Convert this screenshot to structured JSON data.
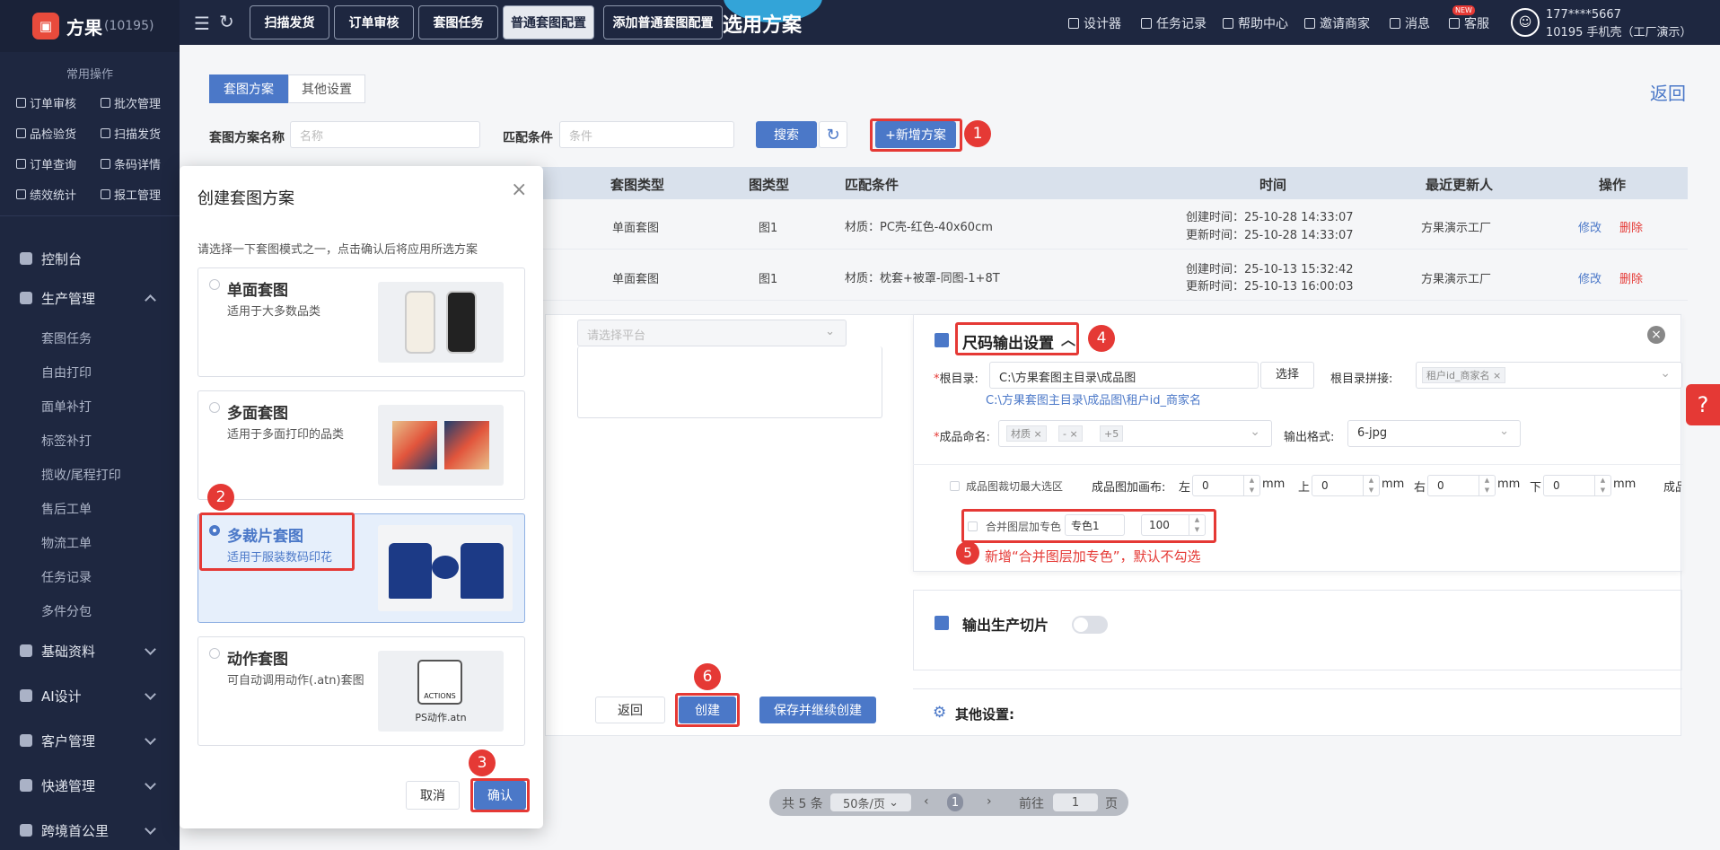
{
  "app": {
    "name": "方果",
    "account": "(10195)"
  },
  "sidebar": {
    "common_title": "常用操作",
    "quick": [
      "订单审核",
      "批次管理",
      "品检验货",
      "扫描发货",
      "订单查询",
      "条码详情",
      "绩效统计",
      "报工管理"
    ],
    "menus": [
      {
        "label": "控制台"
      },
      {
        "label": "生产管理"
      },
      {
        "label": "基础资料"
      },
      {
        "label": "AI设计"
      },
      {
        "label": "客户管理"
      },
      {
        "label": "快递管理"
      },
      {
        "label": "跨境首公里"
      }
    ],
    "submenu": [
      "套图任务",
      "自由打印",
      "面单补打",
      "标签补打",
      "揽收/尾程打印",
      "售后工单",
      "物流工单",
      "任务记录",
      "多件分包"
    ]
  },
  "topbar": {
    "tabs": [
      "扫描发货",
      "订单审核",
      "套图任务",
      "普通套图配置",
      "添加普通套图配置"
    ],
    "page_title_fragment": "选用方案",
    "nav": [
      "设计器",
      "任务记录",
      "帮助中心",
      "邀请商家",
      "消息",
      "客服"
    ],
    "new_badge": "NEW",
    "user_phone": "177****5667",
    "user_info": "10195 手机壳（工厂演示）"
  },
  "main": {
    "tabs": [
      "套图方案",
      "其他设置"
    ],
    "back_label": "返回",
    "filters": {
      "name_label": "套图方案名称",
      "name_placeholder": "名称",
      "cond_label": "匹配条件",
      "cond_placeholder": "条件",
      "search_label": "搜索",
      "add_label": "+新增方案"
    },
    "table": {
      "columns": [
        "套图类型",
        "图类型",
        "匹配条件",
        "时间",
        "最近更新人",
        "操作"
      ],
      "rows": [
        {
          "type": "单面套图",
          "img": "图1",
          "cond": "材质：PC壳-红色-40x60cm",
          "created": "创建时间：25-10-28 14:33:07",
          "updated": "更新时间：25-10-28 14:33:07",
          "updater": "方果演示工厂",
          "edit": "修改",
          "del": "删除"
        },
        {
          "type": "单面套图",
          "img": "图1",
          "cond": "材质：枕套+被罩-同图-1+8T",
          "created": "创建时间：25-10-13 15:32:42",
          "updated": "更新时间：25-10-13 16:00:03",
          "updater": "方果演示工厂",
          "edit": "修改",
          "del": "删除"
        }
      ]
    },
    "pager": {
      "total": "共 5 条",
      "size": "50条/页",
      "page": "1",
      "goto": "前往",
      "goto_val": "1",
      "unit": "页"
    }
  },
  "panel": {
    "platform_placeholder": "请选择平台",
    "size_title": "尺码输出设置",
    "root_label": "根目录:",
    "root_value": "C:\\方果套图主目录\\成品图",
    "root_choose": "选择",
    "root_concat_label": "根目录拼接:",
    "root_concat_tag": "租户id_商家名",
    "root_path_hint": "C:\\方果套图主目录\\成品图\\租户id_商家名",
    "name_label": "成品命名:",
    "name_tags": [
      "材质",
      "-",
      "+5"
    ],
    "format_label": "输出格式:",
    "format_value": "6-jpg",
    "crop_label": "成品图裁切最大选区",
    "canvas_label": "成品图加画布:",
    "dirs": [
      "左",
      "上",
      "右",
      "下"
    ],
    "dir_values": [
      "0",
      "0",
      "0",
      "0"
    ],
    "mm": "mm",
    "cut_label": "成品",
    "merge_label": "合并图层加专色",
    "merge_color": "专色1",
    "merge_value": "100",
    "annotation5": "新增“合并图层加专色”，默认不勾选",
    "slice_title": "输出生产切片",
    "other_title": "其他设置:",
    "back_btn": "返回",
    "create_btn": "创建",
    "save_continue_btn": "保存并继续创建"
  },
  "modal": {
    "title": "创建套图方案",
    "desc": "请选择一下套图模式之一，点击确认后将应用所选方案",
    "options": [
      {
        "title": "单面套图",
        "desc": "适用于大多数品类"
      },
      {
        "title": "多面套图",
        "desc": "适用于多面打印的品类"
      },
      {
        "title": "多裁片套图",
        "desc": "适用于服装数码印花"
      },
      {
        "title": "动作套图",
        "desc": "可自动调用动作(.atn)套图"
      }
    ],
    "action_text": "ACTIONS",
    "action_file": "PS动作.atn",
    "cancel": "取消",
    "confirm": "确认"
  },
  "annotations": [
    "1",
    "2",
    "3",
    "4",
    "5",
    "6"
  ],
  "colors": {
    "accent": "#4b78c8",
    "danger": "#e53935",
    "sidebar": "#1e2740"
  }
}
